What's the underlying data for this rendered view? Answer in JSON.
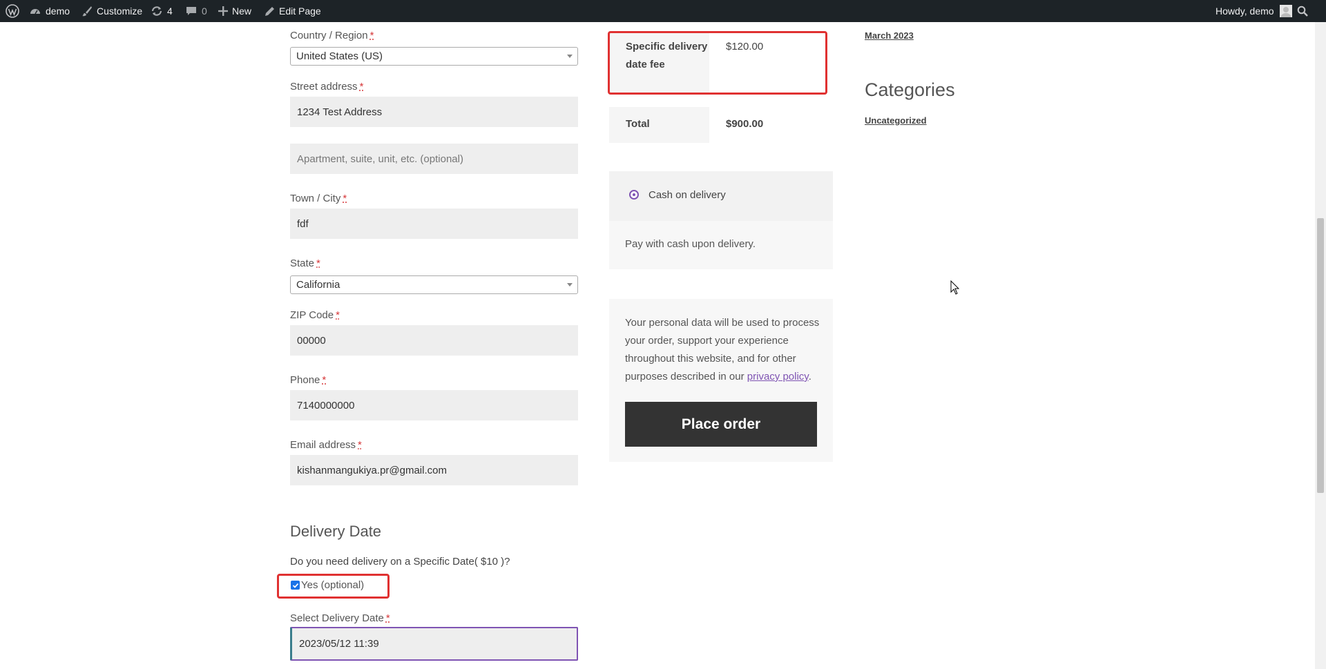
{
  "admin_bar": {
    "site_name": "demo",
    "customize": "Customize",
    "updates_count": "4",
    "comments_count": "0",
    "new": "New",
    "edit_page": "Edit Page",
    "greeting": "Howdy, demo"
  },
  "billing": {
    "country": {
      "label": "Country / Region",
      "required": "*",
      "value": "United States (US)"
    },
    "street": {
      "label": "Street address",
      "required": "*",
      "value": "1234 Test Address",
      "apartment_placeholder": "Apartment, suite, unit, etc. (optional)"
    },
    "city": {
      "label": "Town / City",
      "required": "*",
      "value": "fdf"
    },
    "state": {
      "label": "State",
      "required": "*",
      "value": "California"
    },
    "zip": {
      "label": "ZIP Code",
      "required": "*",
      "value": "00000"
    },
    "phone": {
      "label": "Phone",
      "required": "*",
      "value": "7140000000"
    },
    "email": {
      "label": "Email address",
      "required": "*",
      "value": "kishanmangukiya.pr@gmail.com"
    }
  },
  "delivery": {
    "heading": "Delivery Date",
    "question": "Do you need delivery on a Specific Date( $10 )?",
    "checkbox_label": "Yes (optional)",
    "checkbox_checked": true,
    "date_label": "Select Delivery Date",
    "date_required": "*",
    "date_value": "2023/05/12 11:39"
  },
  "order_review": {
    "fee_label": "Specific delivery date fee",
    "fee_value": "$120.00",
    "total_label": "Total",
    "total_value": "$900.00"
  },
  "payment": {
    "method_label": "Cash on delivery",
    "method_description": "Pay with cash upon delivery.",
    "privacy_text": "Your personal data will be used to process your order, support your experience throughout this website, and for other purposes described in our",
    "privacy_link": "privacy policy",
    "privacy_end": ".",
    "place_order": "Place order"
  },
  "sidebar": {
    "archive_link": "March 2023",
    "categories_heading": "Categories",
    "category_link": "Uncategorized"
  },
  "colors": {
    "admin_bar_bg": "#1d2327",
    "highlight": "#e03131",
    "accent_purple": "#7f54b3",
    "button_bg": "#333333"
  }
}
